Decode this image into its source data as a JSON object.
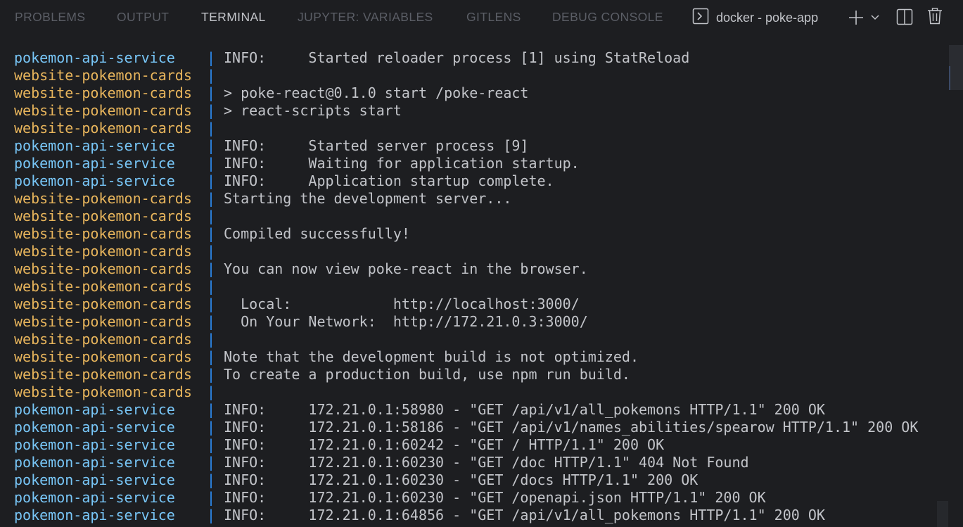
{
  "panel": {
    "tabs": [
      {
        "label": "PROBLEMS"
      },
      {
        "label": "OUTPUT"
      },
      {
        "label": "TERMINAL"
      },
      {
        "label": "JUPYTER: VARIABLES"
      },
      {
        "label": "GITLENS"
      },
      {
        "label": "DEBUG CONSOLE"
      }
    ],
    "active_tab": "TERMINAL",
    "terminal_name": "docker - poke-app",
    "icons": {
      "terminal": "terminal-icon",
      "new_terminal": "plus-icon",
      "dropdown": "chevron-down-icon",
      "split": "split-icon",
      "kill": "trash-icon"
    }
  },
  "colors": {
    "api_service": "#78c6f7",
    "web_service": "#e8b55c",
    "separator": "#2e8ef5",
    "text": "#c2c4c9",
    "background": "#1d1e21"
  },
  "terminal": {
    "separator": "|",
    "lines": [
      {
        "service": "pokemon-api-service",
        "kind": "api",
        "text": "INFO:     Started reloader process [1] using StatReload"
      },
      {
        "service": "website-pokemon-cards",
        "kind": "web",
        "text": ""
      },
      {
        "service": "website-pokemon-cards",
        "kind": "web",
        "text": "> poke-react@0.1.0 start /poke-react"
      },
      {
        "service": "website-pokemon-cards",
        "kind": "web",
        "text": "> react-scripts start"
      },
      {
        "service": "website-pokemon-cards",
        "kind": "web",
        "text": ""
      },
      {
        "service": "pokemon-api-service",
        "kind": "api",
        "text": "INFO:     Started server process [9]"
      },
      {
        "service": "pokemon-api-service",
        "kind": "api",
        "text": "INFO:     Waiting for application startup."
      },
      {
        "service": "pokemon-api-service",
        "kind": "api",
        "text": "INFO:     Application startup complete."
      },
      {
        "service": "website-pokemon-cards",
        "kind": "web",
        "text": "Starting the development server..."
      },
      {
        "service": "website-pokemon-cards",
        "kind": "web",
        "text": ""
      },
      {
        "service": "website-pokemon-cards",
        "kind": "web",
        "text": "Compiled successfully!"
      },
      {
        "service": "website-pokemon-cards",
        "kind": "web",
        "text": ""
      },
      {
        "service": "website-pokemon-cards",
        "kind": "web",
        "text": "You can now view poke-react in the browser."
      },
      {
        "service": "website-pokemon-cards",
        "kind": "web",
        "text": ""
      },
      {
        "service": "website-pokemon-cards",
        "kind": "web",
        "text": "  Local:            http://localhost:3000/"
      },
      {
        "service": "website-pokemon-cards",
        "kind": "web",
        "text": "  On Your Network:  http://172.21.0.3:3000/"
      },
      {
        "service": "website-pokemon-cards",
        "kind": "web",
        "text": ""
      },
      {
        "service": "website-pokemon-cards",
        "kind": "web",
        "text": "Note that the development build is not optimized."
      },
      {
        "service": "website-pokemon-cards",
        "kind": "web",
        "text": "To create a production build, use npm run build."
      },
      {
        "service": "website-pokemon-cards",
        "kind": "web",
        "text": ""
      },
      {
        "service": "pokemon-api-service",
        "kind": "api",
        "text": "INFO:     172.21.0.1:58980 - \"GET /api/v1/all_pokemons HTTP/1.1\" 200 OK"
      },
      {
        "service": "pokemon-api-service",
        "kind": "api",
        "text": "INFO:     172.21.0.1:58186 - \"GET /api/v1/names_abilities/spearow HTTP/1.1\" 200 OK"
      },
      {
        "service": "pokemon-api-service",
        "kind": "api",
        "text": "INFO:     172.21.0.1:60242 - \"GET / HTTP/1.1\" 200 OK"
      },
      {
        "service": "pokemon-api-service",
        "kind": "api",
        "text": "INFO:     172.21.0.1:60230 - \"GET /doc HTTP/1.1\" 404 Not Found"
      },
      {
        "service": "pokemon-api-service",
        "kind": "api",
        "text": "INFO:     172.21.0.1:60230 - \"GET /docs HTTP/1.1\" 200 OK"
      },
      {
        "service": "pokemon-api-service",
        "kind": "api",
        "text": "INFO:     172.21.0.1:60230 - \"GET /openapi.json HTTP/1.1\" 200 OK"
      },
      {
        "service": "pokemon-api-service",
        "kind": "api",
        "text": "INFO:     172.21.0.1:64856 - \"GET /api/v1/all_pokemons HTTP/1.1\" 200 OK"
      }
    ]
  }
}
